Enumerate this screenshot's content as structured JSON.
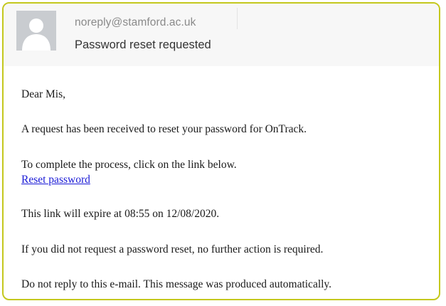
{
  "email": {
    "sender": "noreply@stamford.ac.uk",
    "subject": "Password reset requested",
    "avatar_icon": "person-silhouette-icon",
    "accent_border_color": "#c4c81e",
    "link_color": "#1a1ad6"
  },
  "body": {
    "greeting": "Dear Mis,",
    "request_line": "A request has been received to reset your password for OnTrack.",
    "instruction_line": "To complete the process, click on the link below.",
    "link_text": "Reset password",
    "expiry_line": "This link will expire at 08:55 on 12/08/2020.",
    "no_action_line": "If you did not request a password reset, no further action is required.",
    "no_reply_line": "Do not reply to this e-mail. This message was produced automatically."
  }
}
